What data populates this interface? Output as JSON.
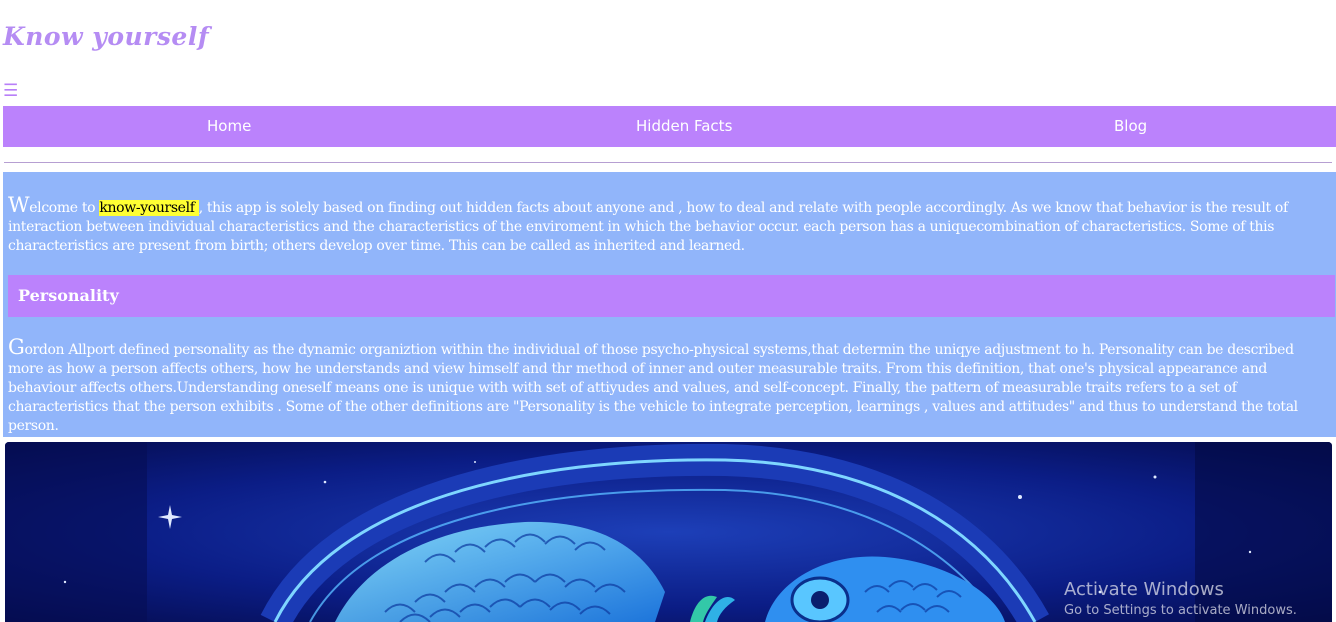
{
  "header": {
    "brand": "Know yourself",
    "menu_icon": "hamburger-menu-icon"
  },
  "nav": {
    "items": [
      {
        "label": "Home"
      },
      {
        "label": "Hidden Facts"
      },
      {
        "label": "Blog"
      }
    ]
  },
  "intro": {
    "dropcap": "W",
    "lead": "elcome to ",
    "highlight": "know-yourself ",
    "body": ", this app is solely based on finding out hidden facts about anyone and , how to deal and relate with people accordingly. As we know that behavior is the result of interaction between individual characteristics and the characteristics of the enviroment in which the behavior occur. each person has a uniquecombination of characteristics. Some of this characteristics are present from birth; others develop over time. This can be called as inherited and learned."
  },
  "personality": {
    "title": "Personality",
    "dropcap": "G",
    "body": "ordon Allport defined personality as the dynamic organiztion within the individual of those psycho-physical systems,that determin the uniqye adjustment to h. Personality can be described more as how a person affects others, how he understands and view himself and thr method of inner and outer measurable traits. From this definition, that one's physical appearance and behaviour affects others.Understanding oneself means one is unique with with set of attiyudes and values, and self-concept. Finally, the pattern of measurable traits refers to a set of characteristics that the person exhibits . Some of the other definitions are \"Personality is the vehicle to integrate perception, learnings , values and attitudes\" and thus to understand the total person."
  },
  "hero": {
    "image": "pisces-zodiac-fish-illustration"
  },
  "os_watermark": {
    "title": "Activate Windows",
    "subtitle": "Go to Settings to activate Windows."
  },
  "colors": {
    "brand": "#b58cf3",
    "nav_bg": "#bb82fc",
    "content_bg": "#91b5fa",
    "highlight": "#ffff33"
  }
}
